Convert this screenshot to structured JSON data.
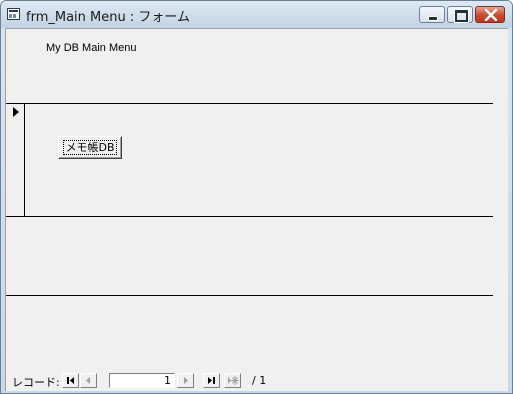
{
  "window": {
    "title": "frm_Main Menu : フォーム"
  },
  "form": {
    "header_label": "My DB Main Menu",
    "memo_button_label": "メモ帳DB"
  },
  "navigation": {
    "caption": "レコード:",
    "current_record": "1",
    "total_text": "/ 1"
  },
  "icons": {
    "app": "form-icon",
    "minimize": "minimize-icon",
    "maximize": "maximize-icon",
    "close": "close-icon",
    "record_selector": "record-pointer-icon",
    "first": "first-record-icon",
    "prev": "previous-record-icon",
    "next": "next-record-icon",
    "last": "last-record-icon",
    "new": "new-record-icon"
  },
  "colors": {
    "close_button": "#c84a31",
    "form_background": "#f0f0f0",
    "titlebar": "#cfdcea"
  }
}
